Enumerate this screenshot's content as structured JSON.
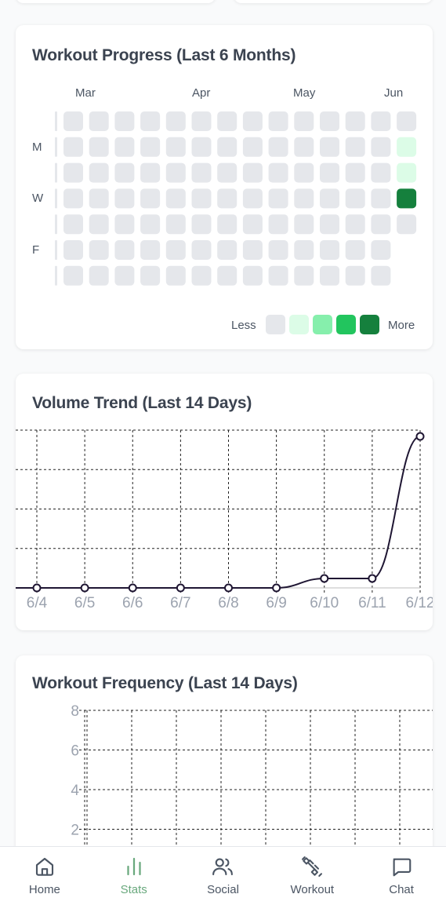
{
  "heatmap": {
    "title": "Workout Progress (Last 6 Months)",
    "months": [
      "Mar",
      "Apr",
      "May",
      "Jun"
    ],
    "day_labels": [
      "M",
      "W",
      "F"
    ],
    "legend": {
      "less": "Less",
      "more": "More",
      "scale_colors": [
        "#e5e7eb",
        "#dcfce7",
        "#86efac",
        "#22c55e",
        "#15803d"
      ]
    },
    "weeks": 14,
    "active_days": [
      {
        "week": 13,
        "day": 1,
        "level": 1
      },
      {
        "week": 13,
        "day": 2,
        "level": 1
      },
      {
        "week": 13,
        "day": 3,
        "level": 4
      }
    ],
    "last_week_days": 5,
    "second_last_week_days": 7
  },
  "volume": {
    "title": "Volume Trend (Last 14 Days)",
    "chart_data": {
      "type": "line",
      "x": [
        "6/4",
        "6/5",
        "6/6",
        "6/7",
        "6/8",
        "6/9",
        "6/10",
        "6/11",
        "6/12"
      ],
      "values": [
        0,
        0,
        0,
        0,
        0,
        0,
        0.06,
        0.06,
        0.96
      ],
      "ylim": [
        0,
        1
      ],
      "grid": true
    },
    "line_color": "#1f1633"
  },
  "frequency": {
    "title": "Workout Frequency (Last 14 Days)",
    "chart_data": {
      "type": "bar",
      "y_ticks": [
        "8",
        "6",
        "4",
        "2"
      ],
      "ylim": [
        0,
        8
      ],
      "grid": true
    }
  },
  "nav": {
    "items": [
      {
        "label": "Home",
        "icon": "home-icon"
      },
      {
        "label": "Stats",
        "icon": "bar-chart-icon"
      },
      {
        "label": "Social",
        "icon": "users-icon"
      },
      {
        "label": "Workout",
        "icon": "dumbbell-icon"
      },
      {
        "label": "Chat",
        "icon": "message-icon"
      }
    ],
    "active_color": "#6aa97e"
  }
}
